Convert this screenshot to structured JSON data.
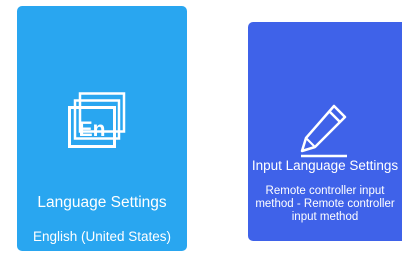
{
  "colors": {
    "language_card_bg": "#29a6f0",
    "input_card_bg": "#3f62e9",
    "text": "#ffffff"
  },
  "cards": [
    {
      "icon": "language-en-icon",
      "icon_text": "En",
      "title": "Language Settings",
      "subtitle": "English (United States)"
    },
    {
      "icon": "pencil-icon",
      "title": "Input Language Settings",
      "subtitle": "Remote controller input method - Remote controller input method"
    }
  ]
}
